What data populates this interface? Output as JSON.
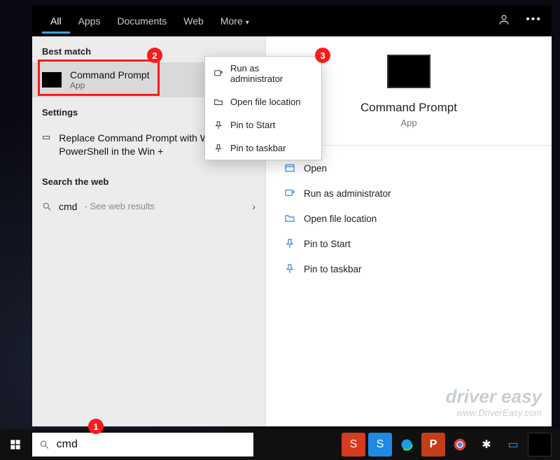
{
  "tabs": {
    "all": "All",
    "apps": "Apps",
    "documents": "Documents",
    "web": "Web",
    "more": "More"
  },
  "left": {
    "best_label": "Best match",
    "best_title": "Command Prompt",
    "best_sub": "App",
    "settings_label": "Settings",
    "settings_text": "Replace Command Prompt with Windows PowerShell in the Win +",
    "search_web_label": "Search the web",
    "cmd": "cmd",
    "cmd_hint": " - See web results"
  },
  "ctx": {
    "run_admin": "Run as administrator",
    "open_loc": "Open file location",
    "pin_start": "Pin to Start",
    "pin_task": "Pin to taskbar"
  },
  "right": {
    "title": "Command Prompt",
    "sub": "App",
    "open": "Open",
    "run_admin": "Run as administrator",
    "open_loc": "Open file location",
    "pin_start": "Pin to Start",
    "pin_task": "Pin to taskbar"
  },
  "search": {
    "value": "cmd"
  },
  "badges": {
    "b1": "1",
    "b2": "2",
    "b3": "3"
  },
  "watermark": {
    "l1": "driver easy",
    "l2": "www.DriverEasy.com"
  }
}
